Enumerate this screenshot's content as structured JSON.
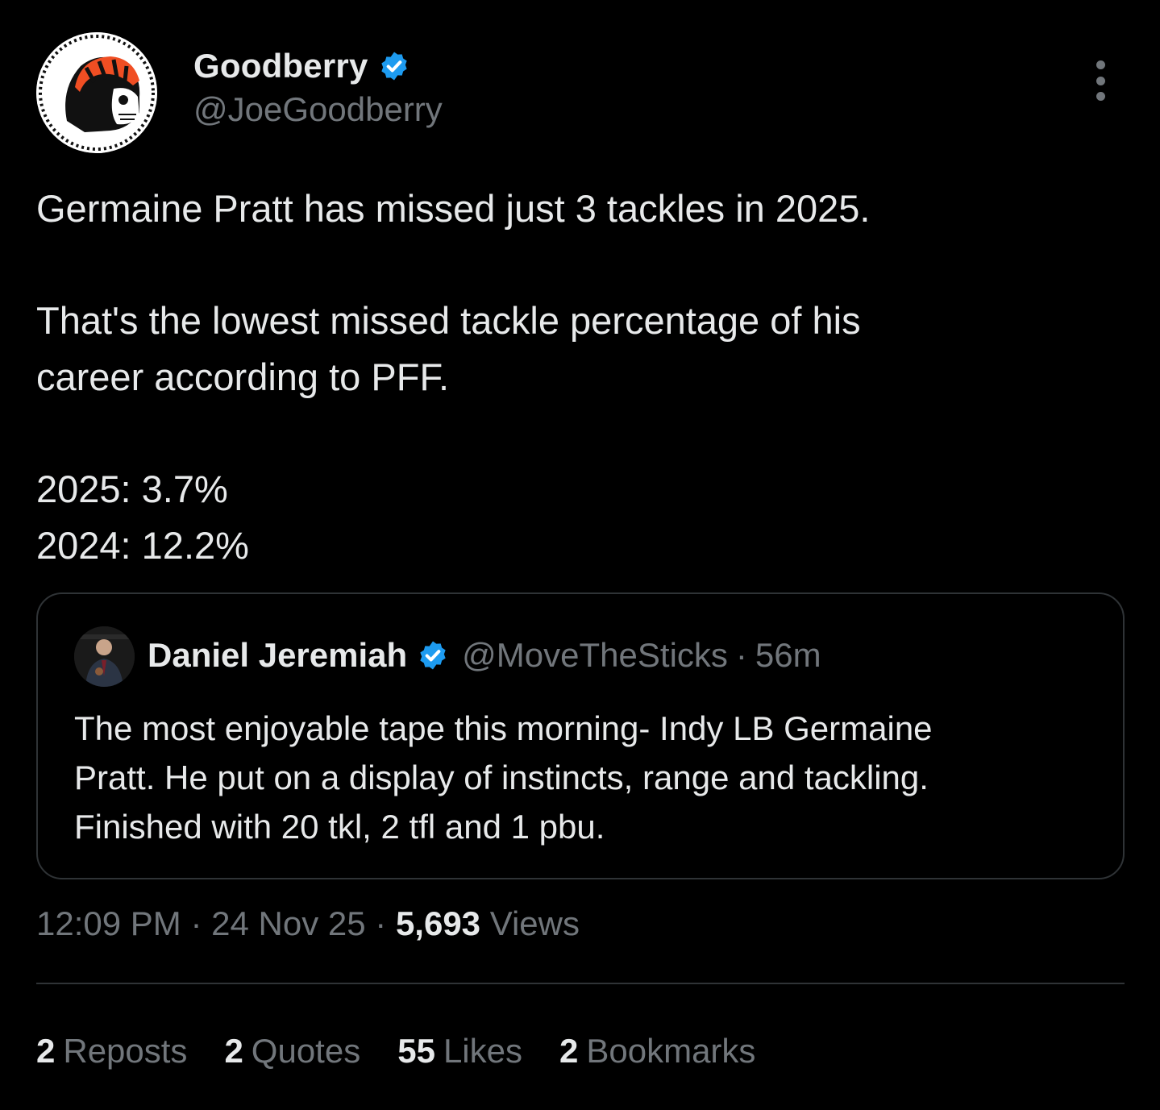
{
  "author": {
    "display_name": "Goodberry",
    "handle": "@JoeGoodberry",
    "verified": true,
    "avatar_icon": "bengals-skull-avatar"
  },
  "tweet": {
    "lines": [
      "Germaine Pratt has missed just 3 tackles in 2025.",
      "That's the lowest missed tackle percentage of his",
      "career according to PFF.",
      "2025: 3.7%",
      "2024: 12.2%"
    ]
  },
  "quote": {
    "display_name": "Daniel Jeremiah",
    "handle": "@MoveTheSticks",
    "separator": "·",
    "time": "56m",
    "verified": true,
    "avatar_icon": "person-avatar",
    "lines": [
      "The most enjoyable tape this morning- Indy LB Germaine",
      "Pratt. He put on a display of instincts, range and tackling.",
      "Finished with 20 tkl, 2 tfl and 1 pbu."
    ]
  },
  "meta": {
    "time": "12:09 PM",
    "separator": "·",
    "date": "24 Nov 25",
    "views_count": "5,693",
    "views_label": "Views"
  },
  "stats": [
    {
      "count": "2",
      "label": "Reposts"
    },
    {
      "count": "2",
      "label": "Quotes"
    },
    {
      "count": "55",
      "label": "Likes"
    },
    {
      "count": "2",
      "label": "Bookmarks"
    }
  ],
  "colors": {
    "background": "#000000",
    "text_primary": "#e7e9ea",
    "text_secondary": "#71767b",
    "border": "#2f3336",
    "verified_blue": "#1d9bf0",
    "avatar_orange": "#f04e23"
  }
}
